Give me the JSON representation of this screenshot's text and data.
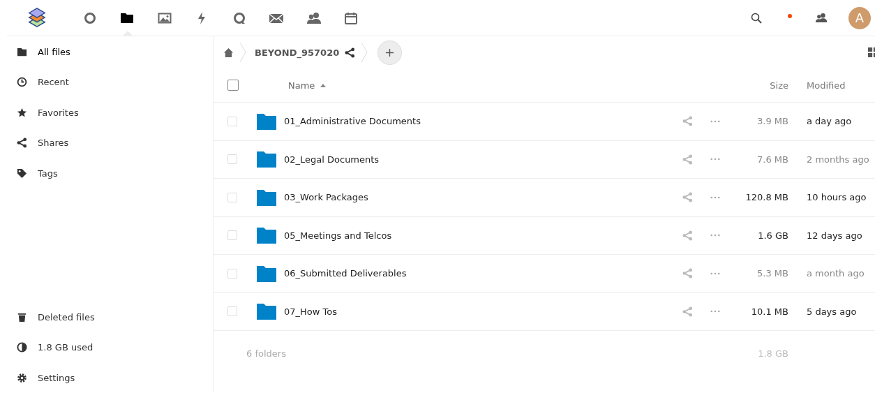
{
  "header": {
    "apps": [
      {
        "kind": "circle",
        "selected": false
      },
      {
        "kind": "folder",
        "selected": true
      },
      {
        "kind": "image",
        "selected": false
      },
      {
        "kind": "bolt",
        "selected": false
      },
      {
        "kind": "chat",
        "selected": false
      },
      {
        "kind": "mail",
        "selected": false
      },
      {
        "kind": "contacts",
        "selected": false
      },
      {
        "kind": "calendar",
        "selected": false
      }
    ],
    "notification_unread": true,
    "avatar_initial": "A"
  },
  "sidebar": {
    "items": [
      {
        "kind": "folder",
        "label": "All files",
        "selected": true
      },
      {
        "kind": "clock",
        "label": "Recent",
        "selected": false
      },
      {
        "kind": "star",
        "label": "Favorites",
        "selected": false
      },
      {
        "kind": "share",
        "label": "Shares",
        "selected": false
      },
      {
        "kind": "tag",
        "label": "Tags",
        "selected": false
      }
    ],
    "bottom_items": [
      {
        "kind": "trash",
        "label": "Deleted files"
      },
      {
        "kind": "pie",
        "label": "1.8 GB used"
      },
      {
        "kind": "gear",
        "label": "Settings"
      }
    ]
  },
  "breadcrumb": {
    "folder": "BEYOND_957020"
  },
  "table": {
    "select_all_checked": false,
    "columns": {
      "name": "Name",
      "size": "Size",
      "modified": "Modified"
    },
    "rows": [
      {
        "name": "01_Administrative Documents",
        "size": "3.9 MB",
        "modified": "a day ago",
        "checked": false,
        "size_emphasized": false,
        "modified_emphasized": true
      },
      {
        "name": "02_Legal Documents",
        "size": "7.6 MB",
        "modified": "2 months ago",
        "checked": false,
        "size_emphasized": false,
        "modified_emphasized": false
      },
      {
        "name": "03_Work Packages",
        "size": "120.8 MB",
        "modified": "10 hours ago",
        "checked": false,
        "size_emphasized": true,
        "modified_emphasized": true
      },
      {
        "name": "05_Meetings and Telcos",
        "size": "1.6 GB",
        "modified": "12 days ago",
        "checked": false,
        "size_emphasized": true,
        "modified_emphasized": true
      },
      {
        "name": "06_Submitted Deliverables",
        "size": "5.3 MB",
        "modified": "a month ago",
        "checked": false,
        "size_emphasized": false,
        "modified_emphasized": false
      },
      {
        "name": "07_How Tos",
        "size": "10.1 MB",
        "modified": "5 days ago",
        "checked": false,
        "size_emphasized": true,
        "modified_emphasized": true
      }
    ],
    "summary": {
      "count": "6 folders",
      "total": "1.8 GB"
    }
  }
}
